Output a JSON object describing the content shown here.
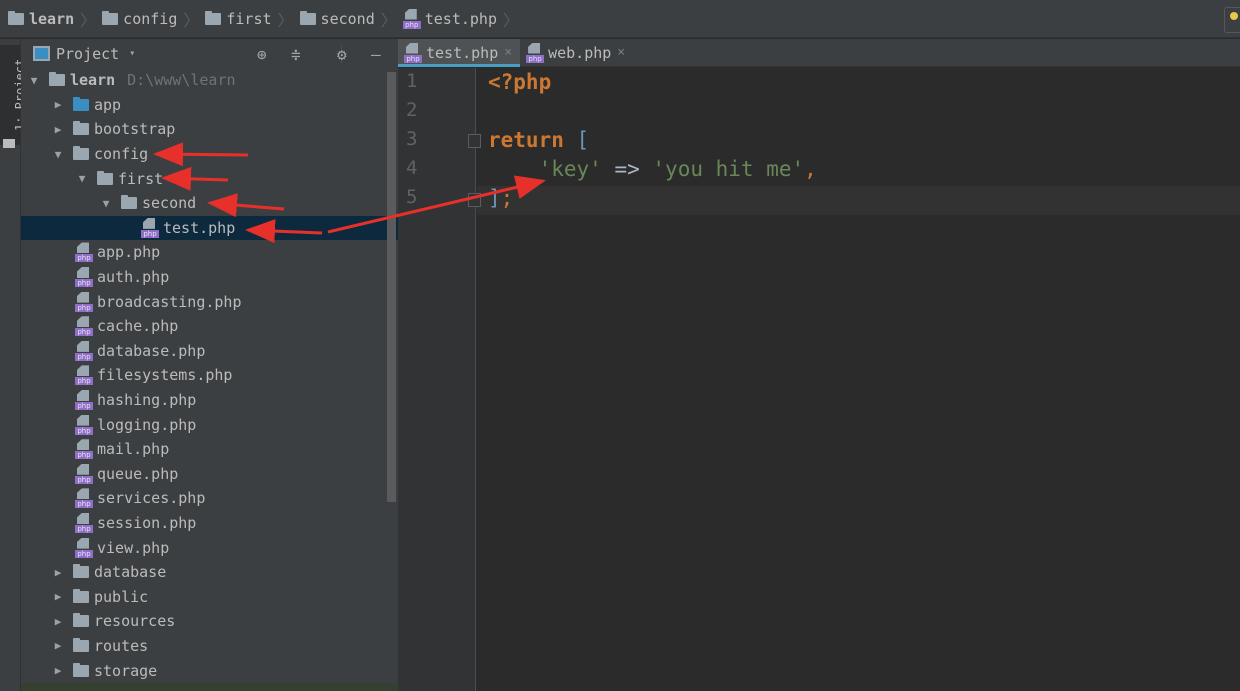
{
  "breadcrumb": {
    "items": [
      {
        "label": "learn",
        "icon": "folder-icon",
        "bold": true
      },
      {
        "label": "config",
        "icon": "folder-icon"
      },
      {
        "label": "first",
        "icon": "folder-icon"
      },
      {
        "label": "second",
        "icon": "folder-icon"
      },
      {
        "label": "test.php",
        "icon": "php-file-icon"
      }
    ],
    "separator": "〉"
  },
  "toolstrip": {
    "project_tab": "1: Project"
  },
  "project_panel": {
    "title": "Project",
    "dropdown_caret": "▾",
    "buttons": {
      "locate": "⊕",
      "collapse": "≑",
      "settings": "⚙",
      "hide": "—"
    },
    "tree": [
      {
        "label": "learn",
        "path": "D:\\www\\learn",
        "type": "folder",
        "expanded": true,
        "bold": true,
        "depth": 0
      },
      {
        "label": "app",
        "type": "folder-blue",
        "expanded": false,
        "depth": 1
      },
      {
        "label": "bootstrap",
        "type": "folder",
        "expanded": false,
        "depth": 1
      },
      {
        "label": "config",
        "type": "folder",
        "expanded": true,
        "depth": 1
      },
      {
        "label": "first",
        "type": "folder",
        "expanded": true,
        "depth": 2
      },
      {
        "label": "second",
        "type": "folder",
        "expanded": true,
        "depth": 3
      },
      {
        "label": "test.php",
        "type": "php",
        "depth": 4,
        "selected": true
      },
      {
        "label": "app.php",
        "type": "php",
        "depth": 2
      },
      {
        "label": "auth.php",
        "type": "php",
        "depth": 2
      },
      {
        "label": "broadcasting.php",
        "type": "php",
        "depth": 2
      },
      {
        "label": "cache.php",
        "type": "php",
        "depth": 2
      },
      {
        "label": "database.php",
        "type": "php",
        "depth": 2
      },
      {
        "label": "filesystems.php",
        "type": "php",
        "depth": 2
      },
      {
        "label": "hashing.php",
        "type": "php",
        "depth": 2
      },
      {
        "label": "logging.php",
        "type": "php",
        "depth": 2
      },
      {
        "label": "mail.php",
        "type": "php",
        "depth": 2
      },
      {
        "label": "queue.php",
        "type": "php",
        "depth": 2
      },
      {
        "label": "services.php",
        "type": "php",
        "depth": 2
      },
      {
        "label": "session.php",
        "type": "php",
        "depth": 2
      },
      {
        "label": "view.php",
        "type": "php",
        "depth": 2
      },
      {
        "label": "database",
        "type": "folder",
        "expanded": false,
        "depth": 1
      },
      {
        "label": "public",
        "type": "folder",
        "expanded": false,
        "depth": 1
      },
      {
        "label": "resources",
        "type": "folder",
        "expanded": false,
        "depth": 1
      },
      {
        "label": "routes",
        "type": "folder",
        "expanded": false,
        "depth": 1
      },
      {
        "label": "storage",
        "type": "folder",
        "expanded": false,
        "depth": 1
      }
    ]
  },
  "editor": {
    "tabs": [
      {
        "label": "test.php",
        "active": true,
        "close": "×"
      },
      {
        "label": "web.php",
        "active": false,
        "close": "×"
      }
    ],
    "line_numbers": [
      "1",
      "2",
      "3",
      "4",
      "5"
    ],
    "lines": {
      "l1": {
        "open_tag": "<?php"
      },
      "l3": {
        "keyword": "return",
        "bracket": "["
      },
      "l4": {
        "key": "'key'",
        "arrow": "=>",
        "value": "'you hit me'",
        "comma": ","
      },
      "l5": {
        "bracket": "]",
        "semicolon": ";"
      }
    }
  },
  "colors": {
    "annotation_arrow": "#e8302a",
    "keyword": "#cc7832",
    "string": "#6a8759",
    "selection": "#0d293e",
    "tab_underline": "#4a9ec4"
  }
}
